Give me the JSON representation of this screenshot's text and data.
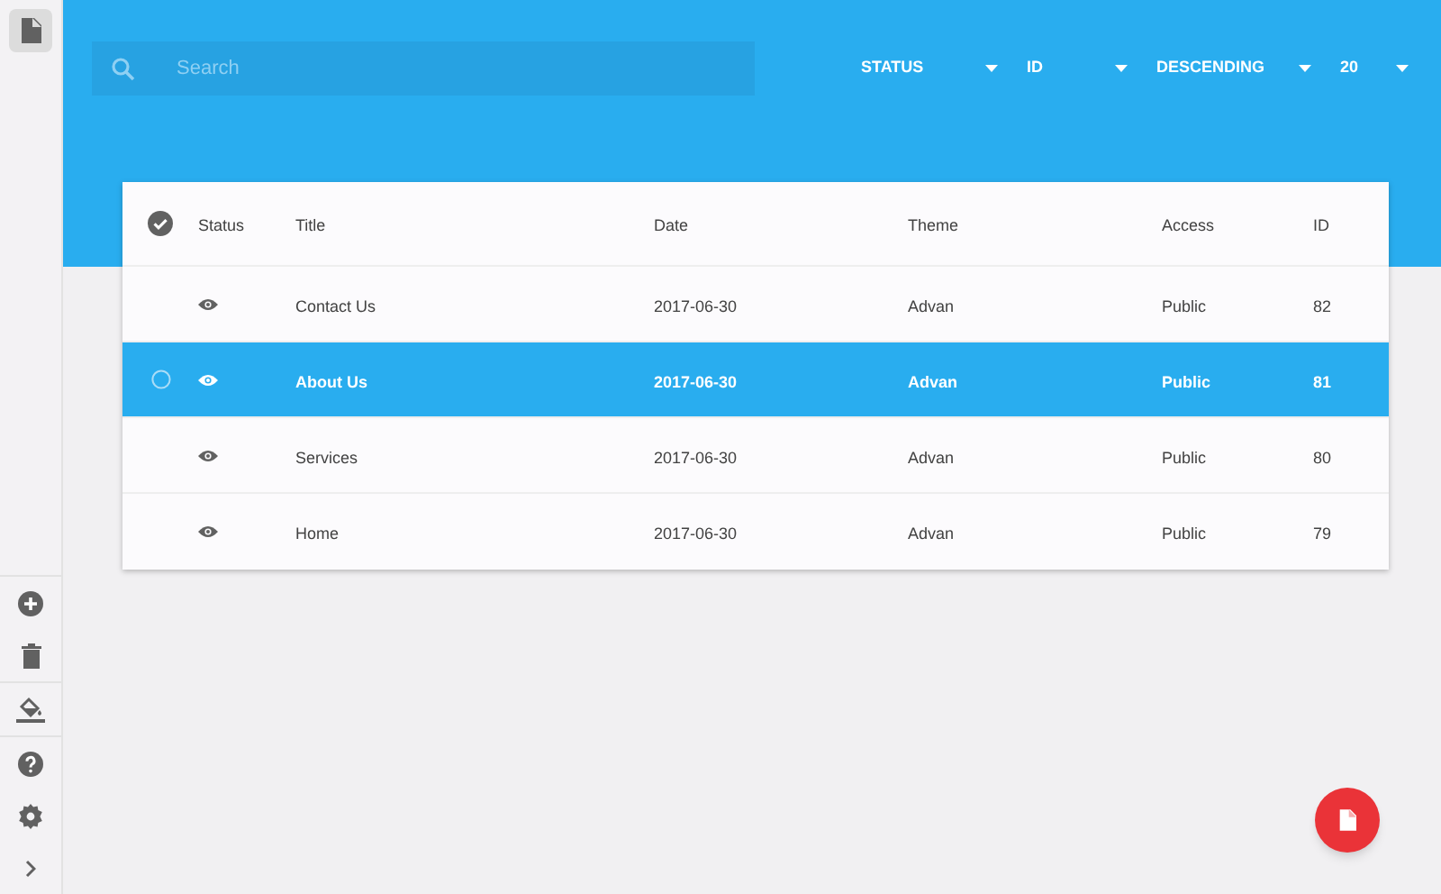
{
  "search": {
    "placeholder": "Search"
  },
  "sort_controls": [
    {
      "label": "STATUS"
    },
    {
      "label": "ID"
    },
    {
      "label": "DESCENDING"
    },
    {
      "label": "20"
    }
  ],
  "table": {
    "columns": [
      "Status",
      "Title",
      "Date",
      "Theme",
      "Access",
      "ID"
    ],
    "rows": [
      {
        "selected": false,
        "title": "Contact Us",
        "date": "2017-06-30",
        "theme": "Advan",
        "access": "Public",
        "id": "82"
      },
      {
        "selected": true,
        "title": "About Us",
        "date": "2017-06-30",
        "theme": "Advan",
        "access": "Public",
        "id": "81"
      },
      {
        "selected": false,
        "title": "Services",
        "date": "2017-06-30",
        "theme": "Advan",
        "access": "Public",
        "id": "80"
      },
      {
        "selected": false,
        "title": "Home",
        "date": "2017-06-30",
        "theme": "Advan",
        "access": "Public",
        "id": "79"
      }
    ]
  }
}
